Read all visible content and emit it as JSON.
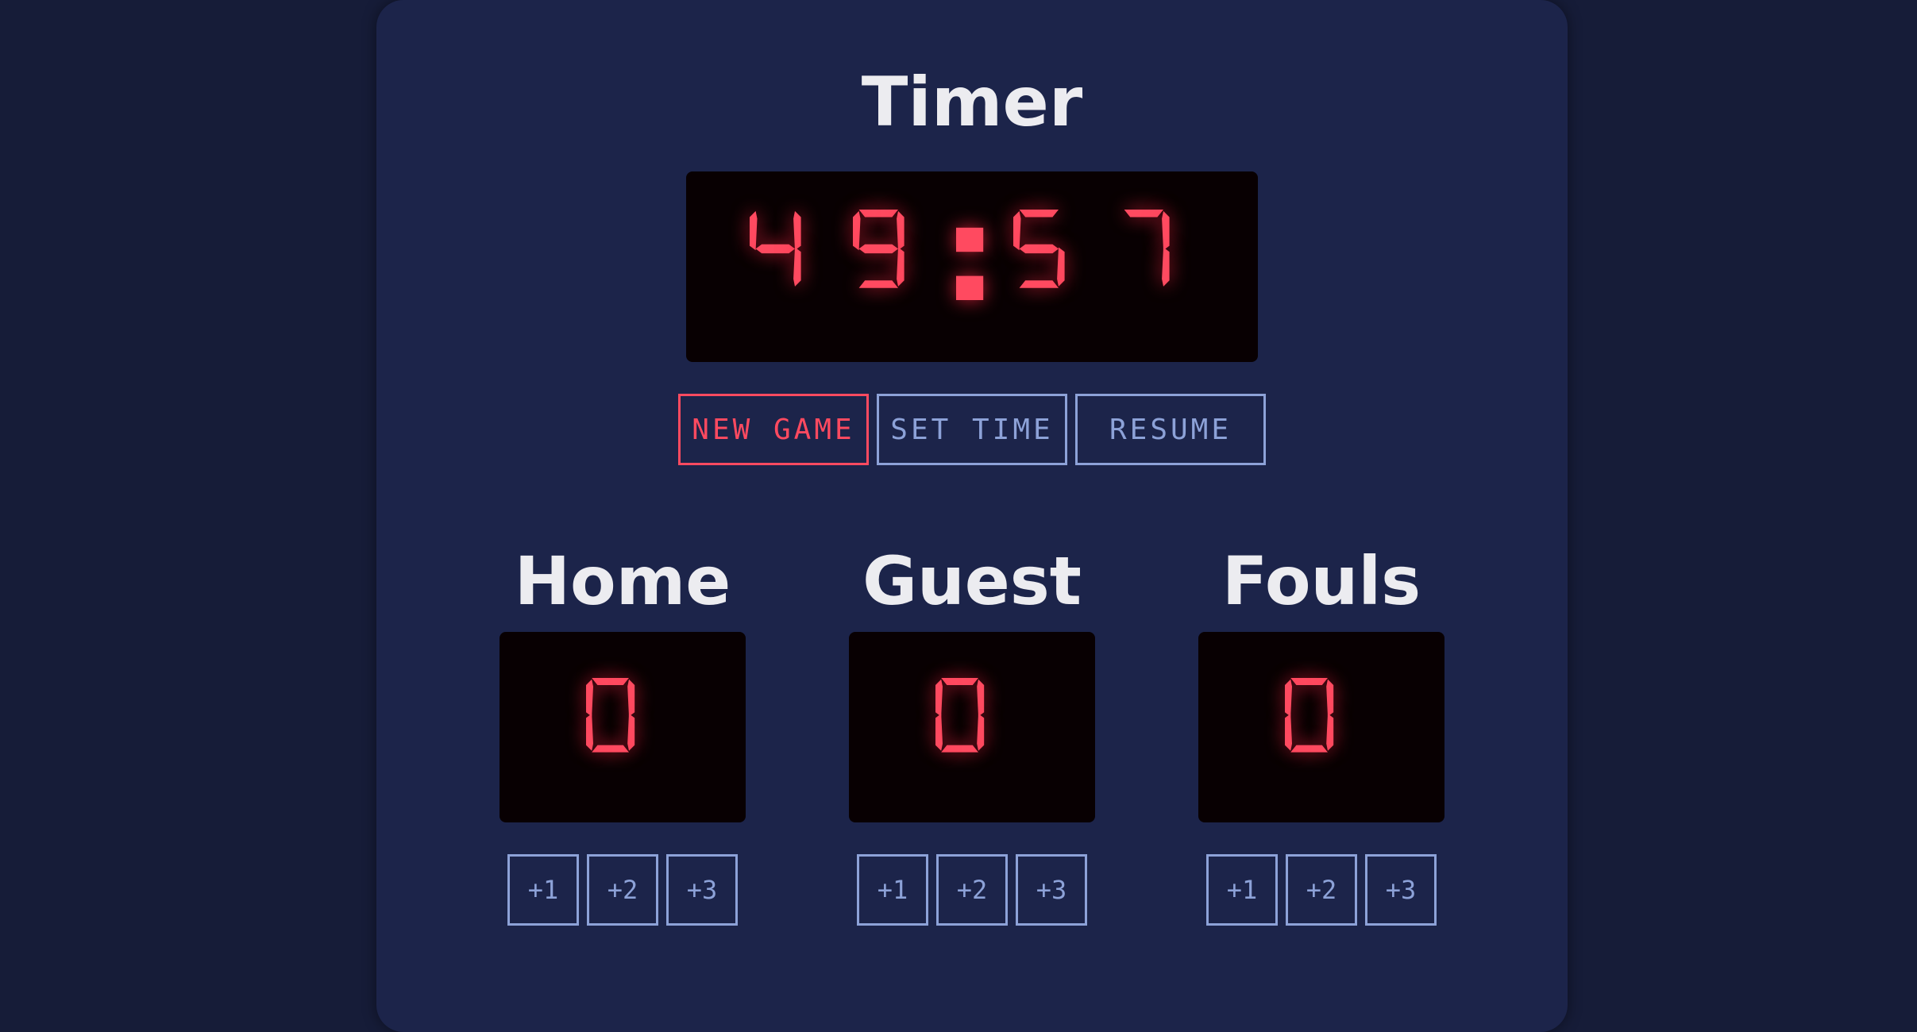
{
  "timer": {
    "title": "Timer",
    "display": "49:57",
    "digits": [
      "4",
      "9",
      "5",
      "7"
    ],
    "colon": ":"
  },
  "controls": {
    "new_game": "NEW GAME",
    "set_time": "SET TIME",
    "resume": "RESUME"
  },
  "scores": [
    {
      "label": "Home",
      "value": "0",
      "buttons": [
        "+1",
        "+2",
        "+3"
      ]
    },
    {
      "label": "Guest",
      "value": "0",
      "buttons": [
        "+1",
        "+2",
        "+3"
      ]
    },
    {
      "label": "Fouls",
      "value": "0",
      "buttons": [
        "+1",
        "+2",
        "+3"
      ]
    }
  ],
  "colors": {
    "background": "#161c38",
    "panel": "#1c244a",
    "display_bg": "#080002",
    "segment_on": "#ff4a60",
    "accent_button": "#ff4a60",
    "button_outline": "#8da2d8",
    "title_text": "#ececf0"
  }
}
